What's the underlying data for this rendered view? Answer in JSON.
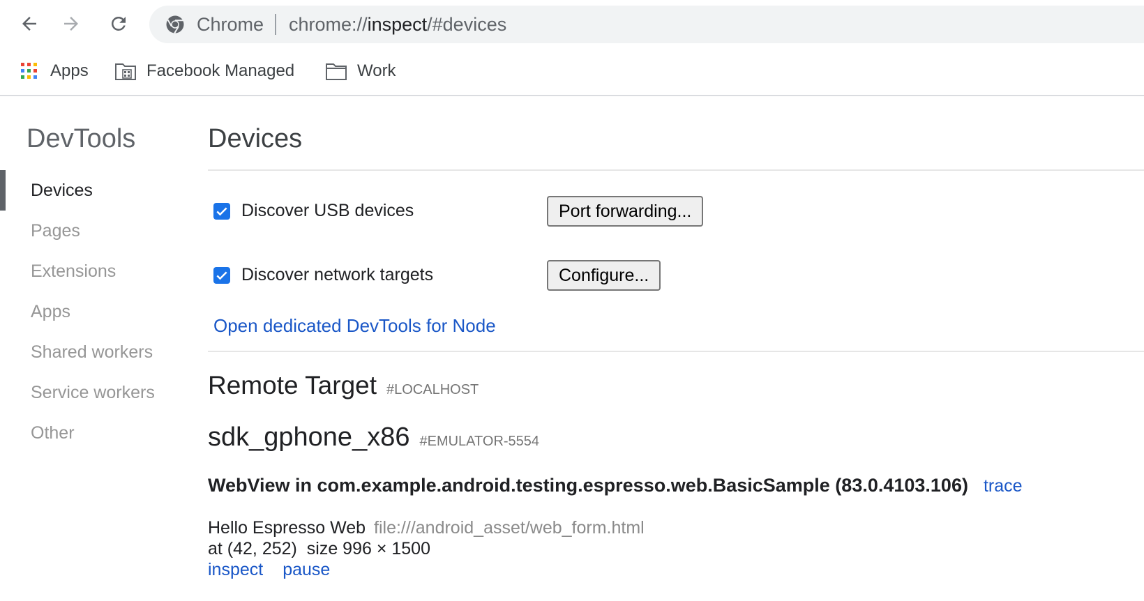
{
  "toolbar": {
    "back_icon": "arrow-left-icon",
    "forward_icon": "arrow-right-icon",
    "reload_icon": "reload-icon",
    "omnibox": {
      "site_icon": "chrome-logo-icon",
      "site_label": "Chrome",
      "url_scheme": "chrome://",
      "url_host": "inspect",
      "url_path": "/#devices"
    }
  },
  "bookmarks": [
    {
      "label": "Apps",
      "icon": "apps-grid-icon"
    },
    {
      "label": "Facebook Managed",
      "icon": "managed-folder-icon"
    },
    {
      "label": "Work",
      "icon": "folder-icon"
    }
  ],
  "sidebar": {
    "title": "DevTools",
    "items": [
      {
        "label": "Devices",
        "active": true
      },
      {
        "label": "Pages"
      },
      {
        "label": "Extensions"
      },
      {
        "label": "Apps"
      },
      {
        "label": "Shared workers"
      },
      {
        "label": "Service workers"
      },
      {
        "label": "Other"
      }
    ]
  },
  "main": {
    "title": "Devices",
    "discover_usb": {
      "label": "Discover USB devices",
      "checked": true,
      "button": "Port forwarding..."
    },
    "discover_network": {
      "label": "Discover network targets",
      "checked": true,
      "button": "Configure..."
    },
    "node_link": "Open dedicated DevTools for Node",
    "remote_target": {
      "title": "Remote Target",
      "tag": "#LOCALHOST"
    },
    "device": {
      "name": "sdk_gphone_x86",
      "serial": "#EMULATOR-5554",
      "browser": {
        "name": "WebView in com.example.android.testing.espresso.web.BasicSample (83.0.4103.106)",
        "trace_label": "trace"
      },
      "page": {
        "title": "Hello Espresso Web",
        "url": "file:///android_asset/web_form.html",
        "position": "at (42, 252)",
        "size": "size 996 × 1500",
        "inspect_label": "inspect",
        "pause_label": "pause"
      }
    }
  },
  "colors": {
    "link": "#1a57c7",
    "checkbox": "#1a73e8",
    "sidebar_inactive": "#969696",
    "omnibox_bg": "#f1f3f4"
  }
}
